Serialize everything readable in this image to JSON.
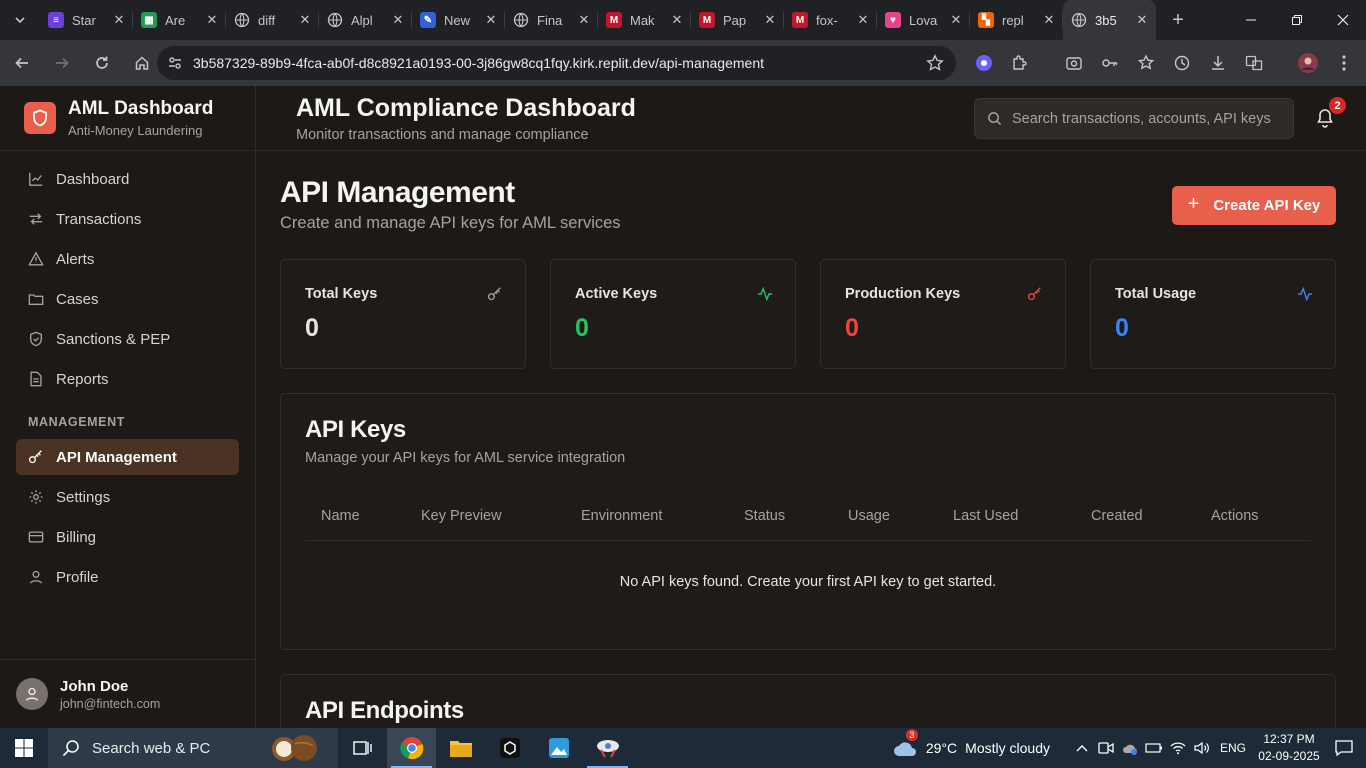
{
  "browser": {
    "tabs": [
      {
        "title": "Star",
        "fav_color": "#6d3fd6",
        "fav_glyph": "≡"
      },
      {
        "title": "Are",
        "fav_color": "#1e9d53",
        "fav_glyph": "▦"
      },
      {
        "title": "diff",
        "fav_color": "",
        "fav_glyph": "globe"
      },
      {
        "title": "Alpl",
        "fav_color": "",
        "fav_glyph": "globe"
      },
      {
        "title": "New",
        "fav_color": "#2f62d8",
        "fav_glyph": "✎"
      },
      {
        "title": "Fina",
        "fav_color": "",
        "fav_glyph": "globe"
      },
      {
        "title": "Mak",
        "fav_color": "#c0172d",
        "fav_glyph": "M"
      },
      {
        "title": "Pap",
        "fav_color": "#c0172d",
        "fav_glyph": "M"
      },
      {
        "title": "fox-",
        "fav_color": "#c0172d",
        "fav_glyph": "M"
      },
      {
        "title": "Lova",
        "fav_color": "#e8428c",
        "fav_glyph": "♥"
      },
      {
        "title": "repl",
        "fav_color": "#f26207",
        "fav_glyph": "▚"
      },
      {
        "title": "3b5",
        "fav_color": "",
        "fav_glyph": "globe"
      }
    ],
    "url": "3b587329-89b9-4fca-ab0f-d8c8921a0193-00-3j86gw8cq1fqy.kirk.replit.dev/api-management"
  },
  "sidebar": {
    "brand_title": "AML Dashboard",
    "brand_subtitle": "Anti-Money Laundering",
    "items": [
      {
        "label": "Dashboard",
        "icon": "chart-line-icon"
      },
      {
        "label": "Transactions",
        "icon": "arrows-icon"
      },
      {
        "label": "Alerts",
        "icon": "warning-icon"
      },
      {
        "label": "Cases",
        "icon": "folder-icon"
      },
      {
        "label": "Sanctions & PEP",
        "icon": "shield-icon"
      },
      {
        "label": "Reports",
        "icon": "document-icon"
      }
    ],
    "section_label": "MANAGEMENT",
    "management_items": [
      {
        "label": "API Management",
        "icon": "key-icon",
        "active": true
      },
      {
        "label": "Settings",
        "icon": "gear-icon"
      },
      {
        "label": "Billing",
        "icon": "card-icon"
      },
      {
        "label": "Profile",
        "icon": "user-icon"
      }
    ],
    "user": {
      "name": "John Doe",
      "email": "john@fintech.com"
    }
  },
  "header": {
    "title": "AML Compliance Dashboard",
    "subtitle": "Monitor transactions and manage compliance",
    "search_placeholder": "Search transactions, accounts, API keys",
    "notification_count": "2"
  },
  "page": {
    "title": "API Management",
    "subtitle": "Create and manage API keys for AML services",
    "create_button": "Create API Key",
    "stats": [
      {
        "label": "Total Keys",
        "value": "0",
        "color": "#e7e5e4",
        "icon": "key-icon"
      },
      {
        "label": "Active Keys",
        "value": "0",
        "color": "#22c55e",
        "icon": "activity-icon"
      },
      {
        "label": "Production Keys",
        "value": "0",
        "color": "#ef4444",
        "icon": "key-icon"
      },
      {
        "label": "Total Usage",
        "value": "0",
        "color": "#3b82f6",
        "icon": "activity-icon"
      }
    ],
    "api_keys": {
      "title": "API Keys",
      "subtitle": "Manage your API keys for AML service integration",
      "columns": [
        "Name",
        "Key Preview",
        "Environment",
        "Status",
        "Usage",
        "Last Used",
        "Created",
        "Actions"
      ],
      "empty_message": "No API keys found. Create your first API key to get started."
    },
    "endpoints_title": "API Endpoints"
  },
  "taskbar": {
    "search_text": "Search web & PC",
    "weather_temp": "29°C",
    "weather_condition": "Mostly cloudy",
    "weather_badge": "3",
    "language": "ENG",
    "time": "12:37 PM",
    "date": "02-09-2025"
  }
}
